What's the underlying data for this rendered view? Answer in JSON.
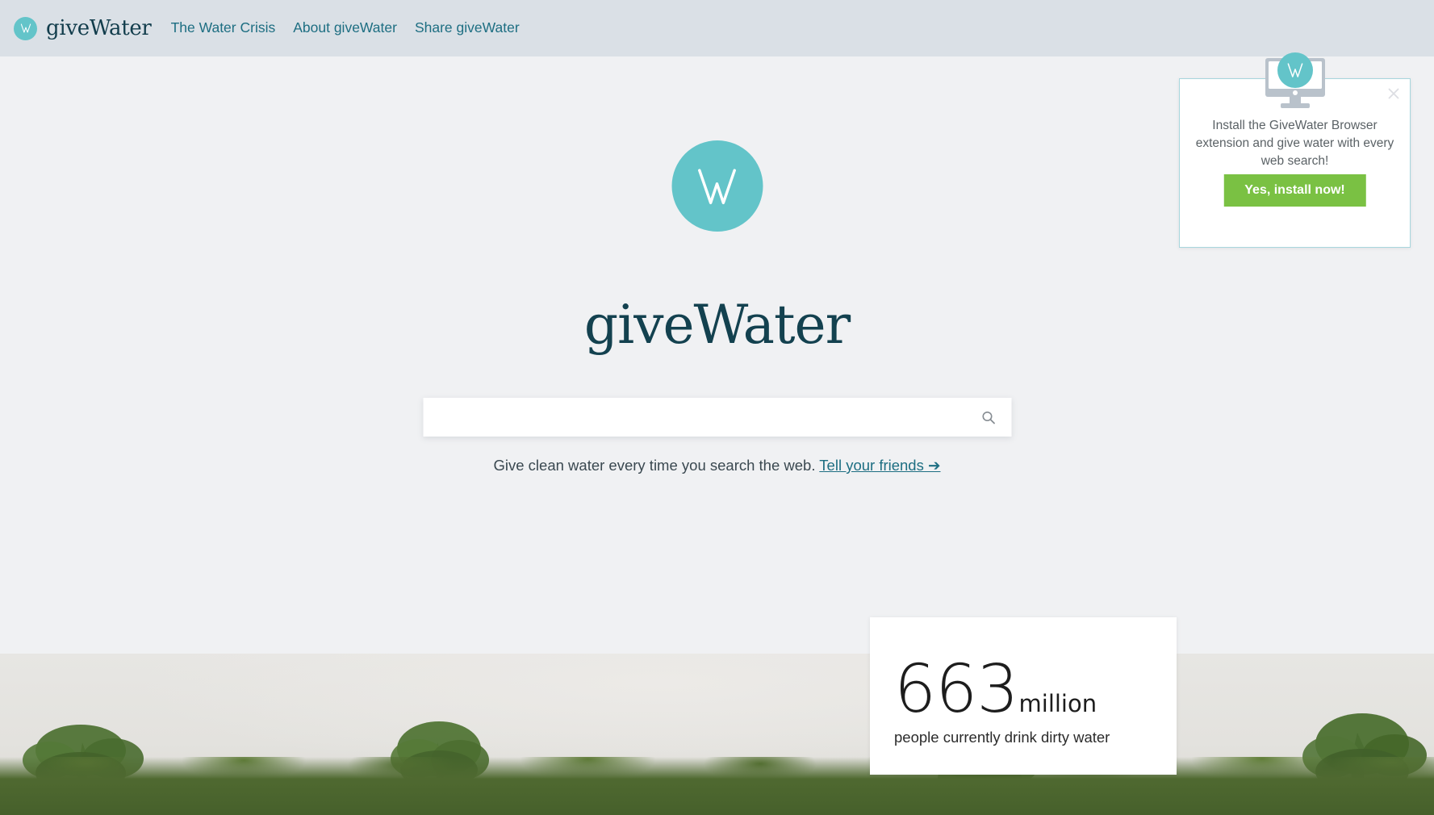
{
  "navbar": {
    "brand": {
      "name": "giveWater",
      "mark_icon": "givewater-w-logo-icon"
    },
    "links": [
      {
        "label": "The Water Crisis"
      },
      {
        "label": "About giveWater"
      },
      {
        "label": "Share giveWater"
      }
    ]
  },
  "hero": {
    "logo_icon": "givewater-w-logo-icon",
    "wordmark": "giveWater",
    "search": {
      "value": "",
      "placeholder": "",
      "submit_icon": "search-icon",
      "submit_label": "Search"
    },
    "tagline_text": "Give clean water every time you search the web.",
    "tagline_link": "Tell your friends ➔"
  },
  "stat_card": {
    "number": "663",
    "unit": "million",
    "caption": "people currently drink dirty water"
  },
  "install_popup": {
    "monitor_icon": "desktop-monitor-icon",
    "logo_icon": "givewater-w-logo-icon",
    "close_icon": "close-icon",
    "close_label": "Close",
    "message": "Install the GiveWater Browser extension and give water with every web search!",
    "cta_label": "Yes, install now!"
  },
  "colors": {
    "navbar_bg": "#dae0e6",
    "page_bg": "#f0f1f3",
    "brand_teal": "#63c4c9",
    "wordmark_navy": "#13414f",
    "nav_link": "#1d6e82",
    "cta_green": "#7ac143",
    "popup_border": "#a8d6dd",
    "card_white": "#ffffff"
  },
  "background_photo": {
    "description": "green tree canopy against pale overcast sky"
  }
}
